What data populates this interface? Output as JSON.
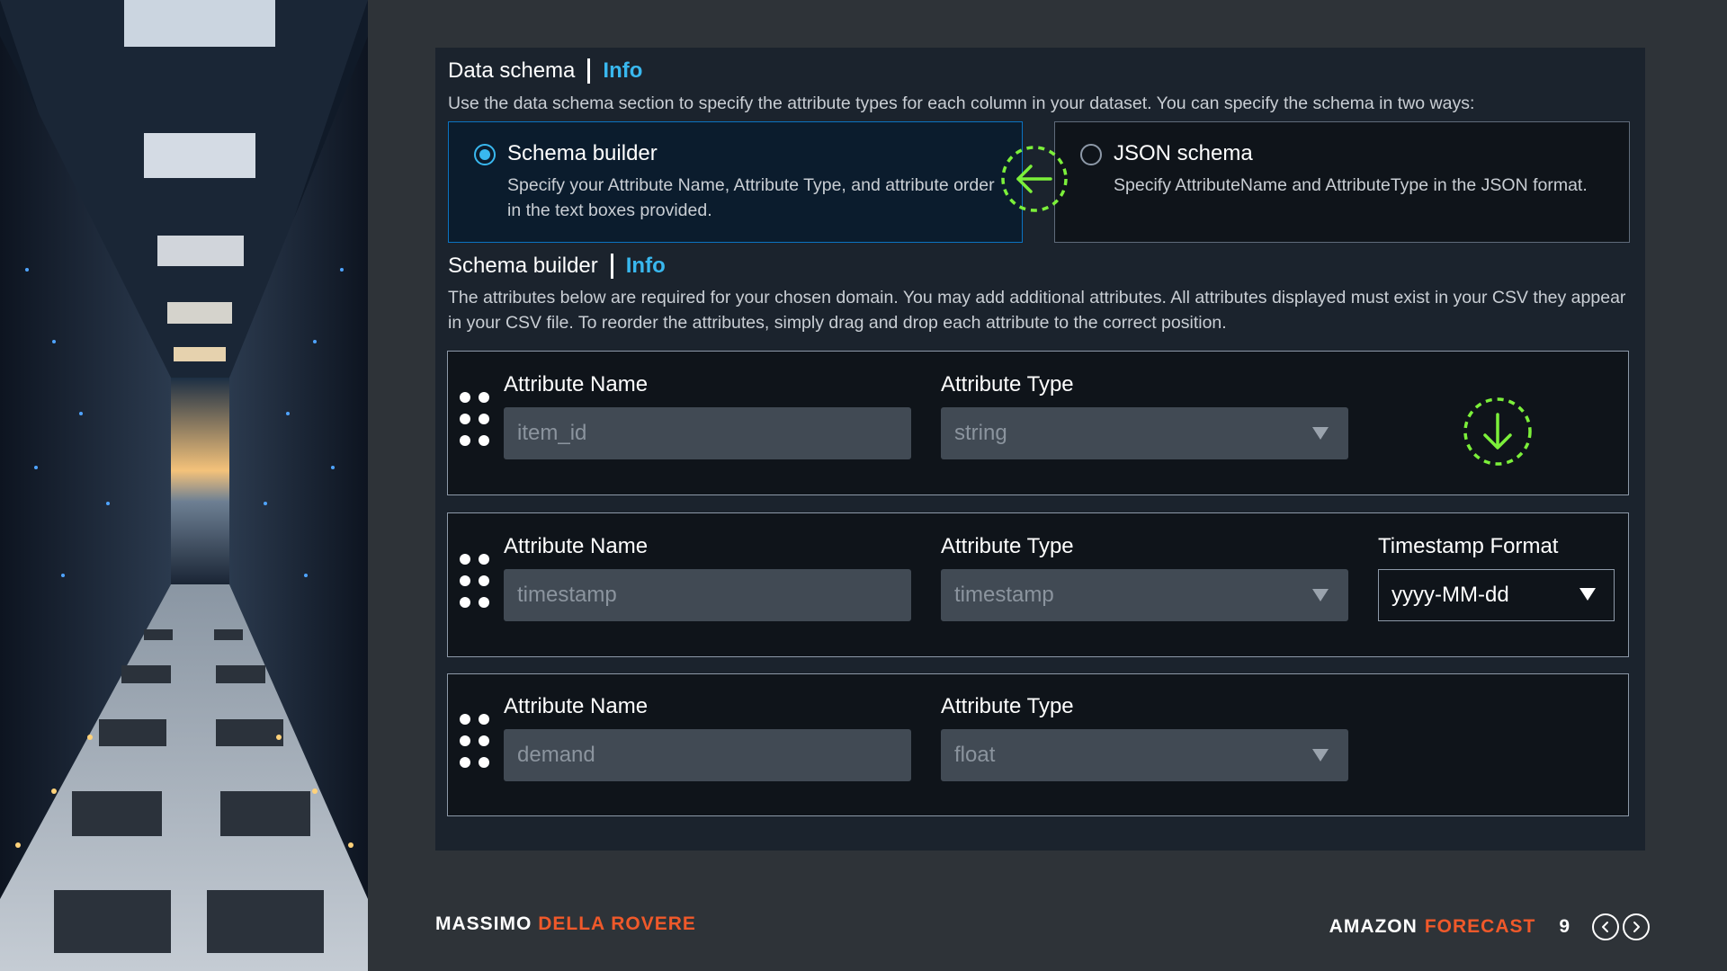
{
  "data_schema": {
    "title": "Data schema",
    "info_link": "Info",
    "description": "Use the data schema section to specify the attribute types for each column in your dataset. You can specify the schema in two ways:",
    "options": [
      {
        "title": "Schema builder",
        "description": "Specify your Attribute Name, Attribute Type, and attribute order in the text boxes provided.",
        "selected": true
      },
      {
        "title": "JSON schema",
        "description": "Specify AttributeName and AttributeType in the JSON format.",
        "selected": false
      }
    ]
  },
  "schema_builder": {
    "title": "Schema builder",
    "info_link": "Info",
    "description": "The attributes below are required for your chosen domain. You may add additional attributes. All attributes displayed must exist in your CSV they appear in your CSV file. To reorder the attributes, simply drag and drop each attribute to the correct position.",
    "attributes": [
      {
        "name_label": "Attribute Name",
        "name_value": "item_id",
        "type_label": "Attribute Type",
        "type_value": "string"
      },
      {
        "name_label": "Attribute Name",
        "name_value": "timestamp",
        "type_label": "Attribute Type",
        "type_value": "timestamp",
        "format_label": "Timestamp Format",
        "format_value": "yyyy-MM-dd"
      },
      {
        "name_label": "Attribute Name",
        "name_value": "demand",
        "type_label": "Attribute Type",
        "type_value": "float"
      }
    ]
  },
  "annotations": {
    "swap_icon": "arrow-left-dashed-circle",
    "down_icon": "arrow-down-dashed-circle",
    "color": "#7cf03a"
  },
  "footer": {
    "author_first": "MASSIMO",
    "author_last": "DELLA ROVERE",
    "product_a": "AMAZON",
    "product_b": "FORECAST",
    "page_number": "9"
  },
  "colors": {
    "accent": "#39b8ef",
    "brand_orange": "#f0592a",
    "selected_border": "#0b73c2"
  }
}
